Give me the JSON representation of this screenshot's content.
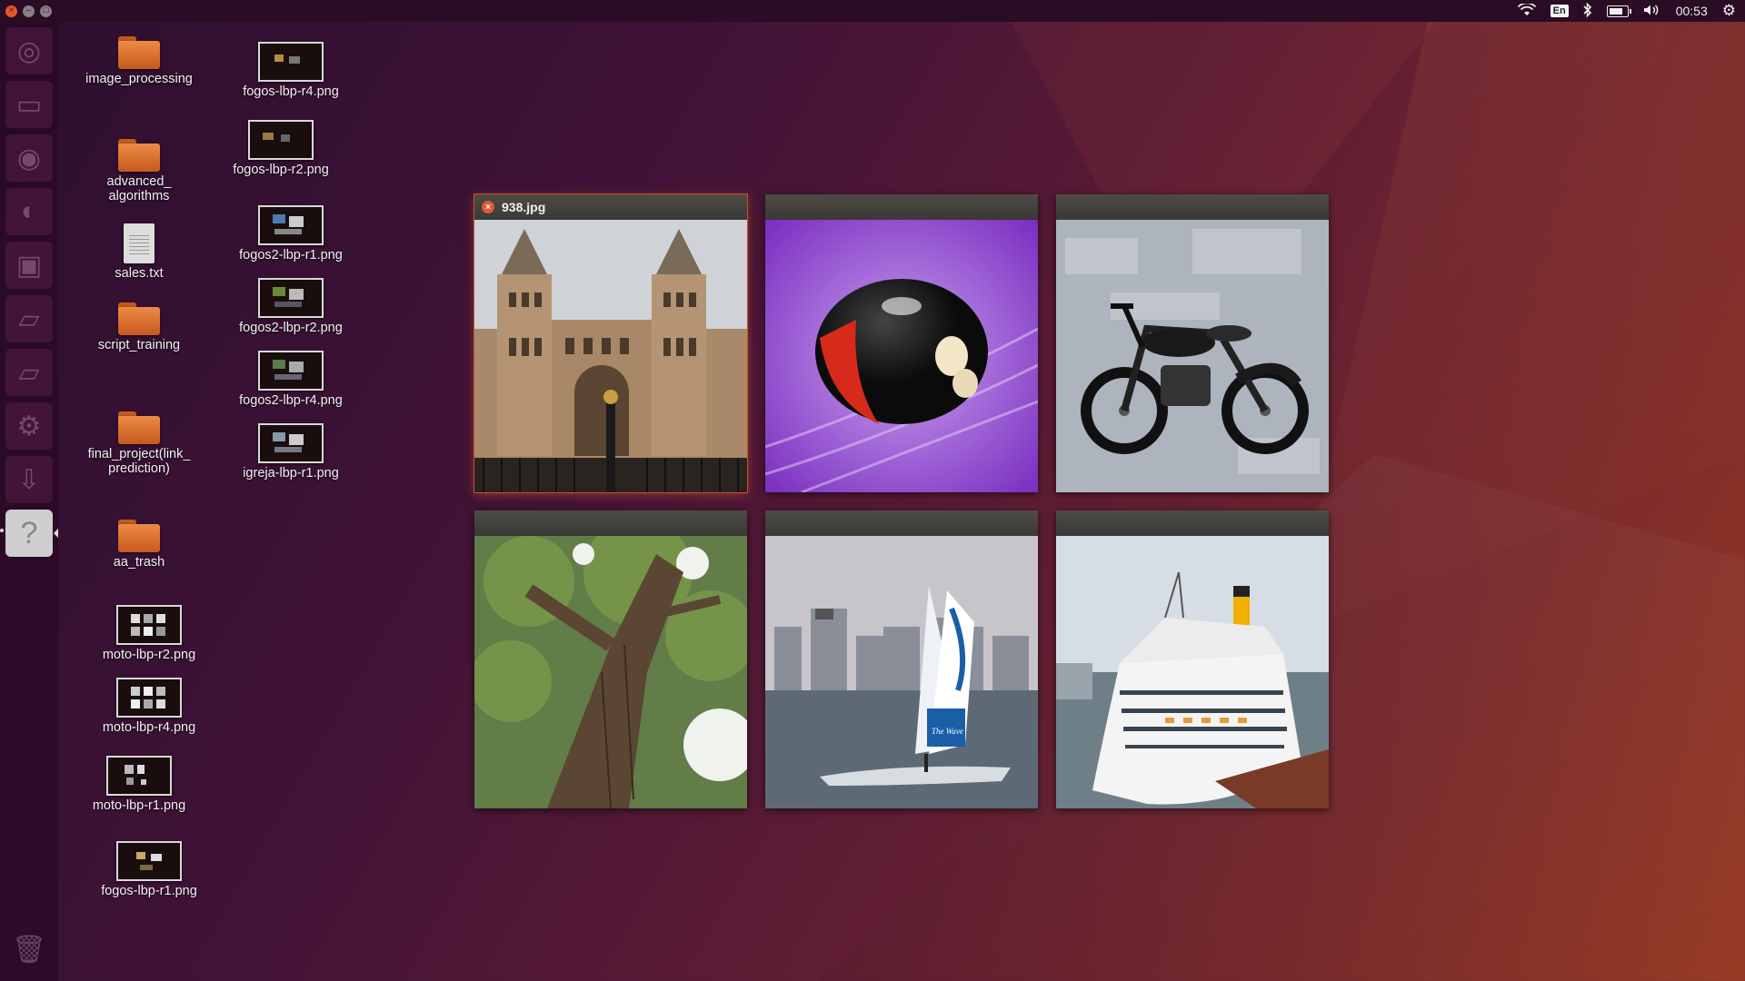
{
  "panel": {
    "time": "00:53",
    "keyboard_layout": "En",
    "battery_level": 0.75,
    "icons": [
      "wifi-icon",
      "keyboard-layout-indicator",
      "bluetooth-icon",
      "battery-icon",
      "volume-icon",
      "clock",
      "power-gear-icon"
    ]
  },
  "launcher": {
    "items": [
      "ubuntu-dash-icon",
      "files-icon",
      "app-icon",
      "app-icon",
      "app-icon",
      "app-icon",
      "app-icon",
      "settings-gear-icon",
      "app-icon",
      "help-icon",
      "trash-icon"
    ],
    "help_glyph": "?"
  },
  "desktop": {
    "col1": [
      {
        "label": "image_processing",
        "kind": "folder"
      },
      {
        "label": "advanced_\nalgorithms",
        "kind": "folder"
      },
      {
        "label": "sales.txt",
        "kind": "text"
      },
      {
        "label": "script_training",
        "kind": "folder"
      },
      {
        "label": "final_project(link_\nprediction)",
        "kind": "folder"
      },
      {
        "label": "aa_trash",
        "kind": "folder"
      },
      {
        "label": "moto-lbp-r2.png",
        "kind": "image"
      },
      {
        "label": "moto-lbp-r4.png",
        "kind": "image"
      },
      {
        "label": "moto-lbp-r1.png",
        "kind": "image"
      },
      {
        "label": "fogos-lbp-r1.png",
        "kind": "image"
      }
    ],
    "col2": [
      {
        "label": "fogos-lbp-r4.png",
        "kind": "image"
      },
      {
        "label": "fogos-lbp-r2.png",
        "kind": "image"
      },
      {
        "label": "fogos2-lbp-r1.png",
        "kind": "image"
      },
      {
        "label": "fogos2-lbp-r2.png",
        "kind": "image"
      },
      {
        "label": "fogos2-lbp-r4.png",
        "kind": "image"
      },
      {
        "label": "igreja-lbp-r1.png",
        "kind": "image"
      }
    ]
  },
  "spread": {
    "windows": [
      {
        "title": "938.jpg",
        "active": true,
        "image": "cathedral"
      },
      {
        "title": "",
        "active": false,
        "image": "ladybug"
      },
      {
        "title": "",
        "active": false,
        "image": "motorcycle"
      },
      {
        "title": "",
        "active": false,
        "image": "tree"
      },
      {
        "title": "",
        "active": false,
        "image": "sailboat"
      },
      {
        "title": "",
        "active": false,
        "image": "cruise-ship"
      }
    ],
    "close_glyph": "×"
  },
  "sailboat_caption": "The Wave"
}
